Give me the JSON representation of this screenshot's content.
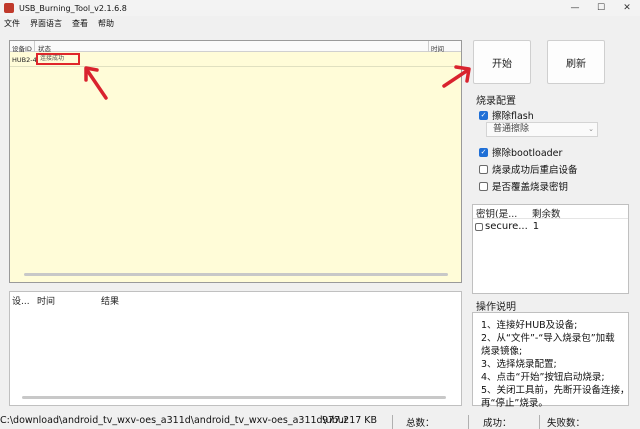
{
  "window": {
    "title": "USB_Burning_Tool_v2.1.6.8",
    "icon": "app-icon",
    "controls": [
      "minimize-icon",
      "maximize-icon",
      "close-icon"
    ]
  },
  "menu": [
    "文件",
    "界面语言",
    "查看",
    "帮助"
  ],
  "device_table": {
    "headers": [
      "设备ID",
      "状态",
      "时间"
    ],
    "rows": [
      {
        "id": "HUB2-4",
        "status": "连接成功",
        "time": ""
      }
    ]
  },
  "log_table": {
    "headers": [
      "设...",
      "时间",
      "结果"
    ]
  },
  "buttons": {
    "start": "开始",
    "refresh": "刷新"
  },
  "burn_config": {
    "title": "烧录配置",
    "erase_flash": {
      "label": "擦除flash",
      "checked": true
    },
    "erase_mode": "普通擦除",
    "erase_bootloader": {
      "label": "擦除bootloader",
      "checked": true
    },
    "reboot_after": {
      "label": "烧录成功后重启设备",
      "checked": false
    },
    "overwrite_key": {
      "label": "是否覆盖烧录密钥",
      "checked": false
    }
  },
  "key_table": {
    "headers": [
      "密钥(是...",
      "剩余数"
    ],
    "rows": [
      {
        "key": "secure...",
        "count": "1",
        "checked": false
      }
    ]
  },
  "operation": {
    "title": "操作说明",
    "lines": [
      "1、连接好HUB及设备;",
      "2、从“文件”-“导入烧录包”加载",
      "烧录镜像;",
      "3、选择烧录配置;",
      "4、点击“开始”按钮启动烧录;",
      "5、关闭工具前，先断开设备连接，",
      "再“停止”烧录。"
    ]
  },
  "status_bar": {
    "path": "C:\\download\\android_tv_wxv-oes_a311d\\android_tv_wxv-oes_a311d\\ubur",
    "size": "977.217 KB",
    "total": "总数：",
    "success": "成功：",
    "fail": "失败数："
  },
  "colors": {
    "device_table_bg": "#fffcd8",
    "highlight_box": "#e0262a",
    "annotation_arrow": "#d9232e",
    "checkbox_checked": "#1f6fd6"
  }
}
